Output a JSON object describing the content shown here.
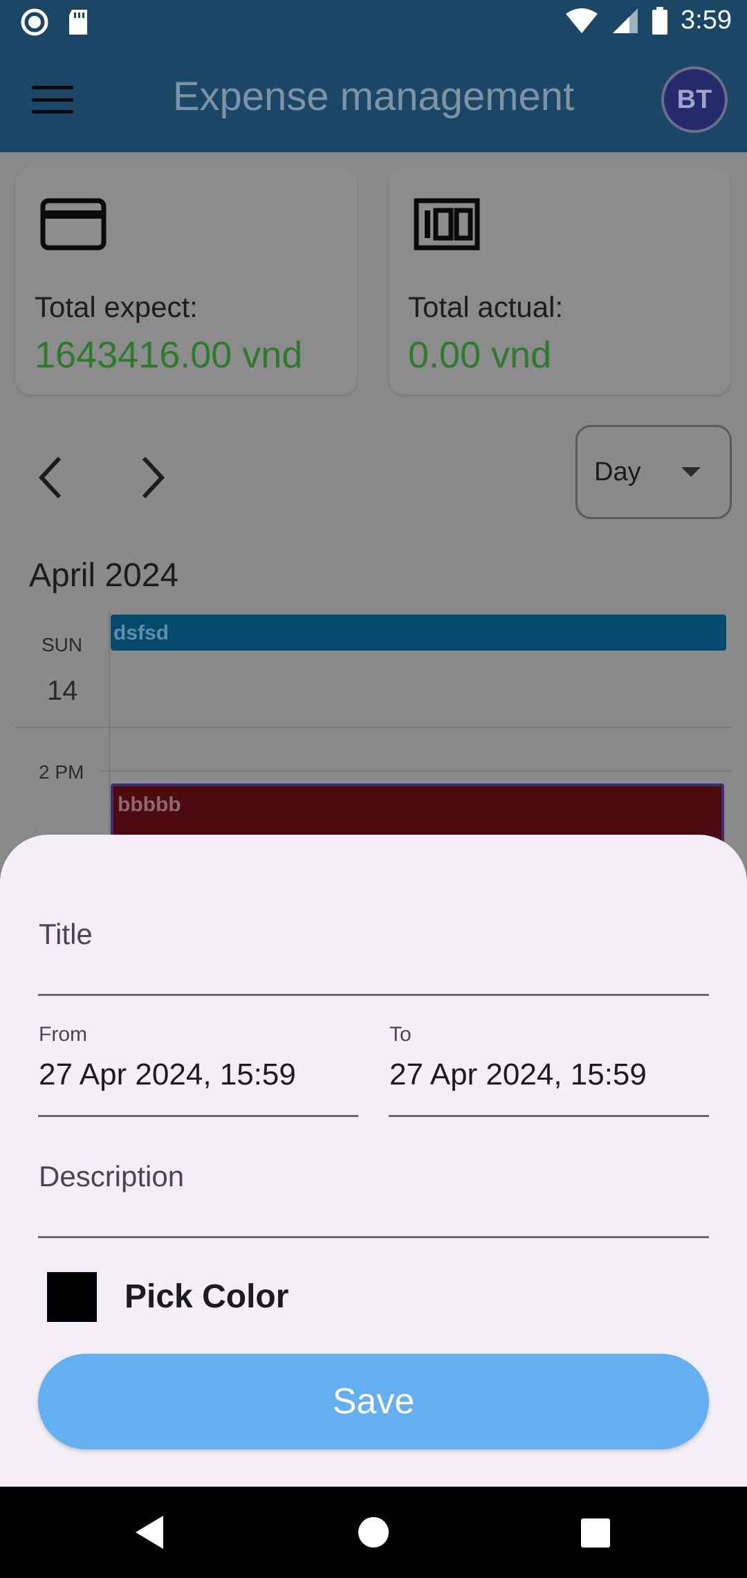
{
  "status_bar": {
    "time": "3:59",
    "icons": [
      "record-icon",
      "sd-card-icon",
      "wifi-icon",
      "signal-icon",
      "battery-icon"
    ]
  },
  "app_bar": {
    "title": "Expense management",
    "avatar_initials": "BT"
  },
  "summary": {
    "expect": {
      "label": "Total expect:",
      "value": "1643416.00 vnd",
      "icon": "credit-card-icon"
    },
    "actual": {
      "label": "Total actual:",
      "value": "0.00 vnd",
      "icon": "hundred-icon"
    }
  },
  "calendar": {
    "view_mode": "Day",
    "month": "April 2024",
    "day_name": "SUN",
    "day_number": "14",
    "time_label": "2 PM",
    "events": [
      {
        "title": "dsfsd"
      },
      {
        "title": "bbbbb"
      }
    ]
  },
  "sheet": {
    "title_label": "Title",
    "from_label": "From",
    "from_value": "27 Apr 2024, 15:59",
    "to_label": "To",
    "to_value": "27 Apr 2024, 15:59",
    "description_label": "Description",
    "pick_color_label": "Pick Color",
    "selected_color": "#000000",
    "save_label": "Save"
  },
  "colors": {
    "primary": "#1b4666",
    "save_button": "#63aff0",
    "value_green": "#2d7a2d"
  }
}
